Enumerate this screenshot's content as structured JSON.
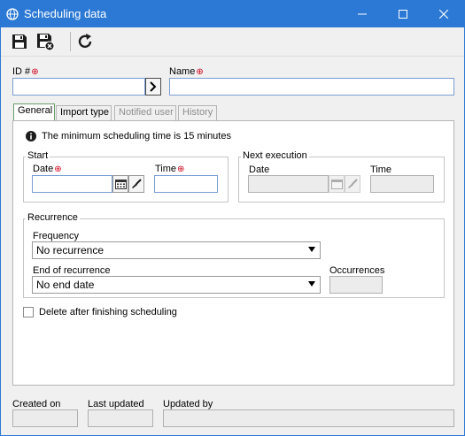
{
  "window": {
    "title": "Scheduling data"
  },
  "fields": {
    "id_label": "ID #",
    "name_label": "Name",
    "id_value": "",
    "name_value": ""
  },
  "tabs": [
    {
      "label": "General",
      "state": "active"
    },
    {
      "label": "Import type",
      "state": "enabled"
    },
    {
      "label": "Notified user",
      "state": "disabled"
    },
    {
      "label": "History",
      "state": "disabled"
    }
  ],
  "general": {
    "info_text": "The minimum scheduling time is 15 minutes",
    "start": {
      "title": "Start",
      "date_label": "Date",
      "time_label": "Time",
      "date_value": "",
      "time_value": ""
    },
    "next_execution": {
      "title": "Next execution",
      "date_label": "Date",
      "time_label": "Time"
    },
    "recurrence": {
      "title": "Recurrence",
      "frequency_label": "Frequency",
      "frequency_value": "No recurrence",
      "end_label": "End of recurrence",
      "end_value": "No end date",
      "occurrences_label": "Occurrences"
    },
    "delete_after_label": "Delete after finishing scheduling"
  },
  "footer": {
    "created_on_label": "Created on",
    "last_updated_label": "Last updated",
    "updated_by_label": "Updated by"
  },
  "colors": {
    "titlebar": "#2b79d4",
    "required": "#d0021b"
  }
}
